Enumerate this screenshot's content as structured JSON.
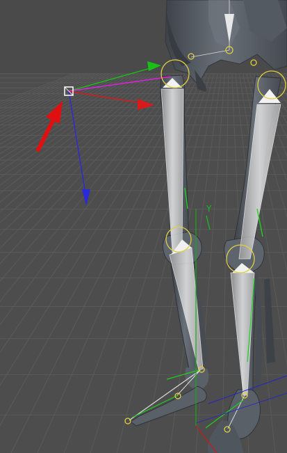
{
  "viewport": {
    "background": "#4a4a4a",
    "grid_color": "#5a5a5a",
    "floor_color": "#505050"
  },
  "axes": {
    "world_y_label": "Y",
    "x_color": "#d81a1a",
    "y_color": "#18c018",
    "z_color": "#2424c8",
    "ik_line_color": "#e020e0"
  },
  "annotation": {
    "arrow_color": "#e01010"
  },
  "skeleton": {
    "bone_color": "#5d636c",
    "bone_highlight": "#8a9098",
    "rig_bone_color": "#d8d8d8",
    "joint_circle_color": "#e0d040"
  }
}
